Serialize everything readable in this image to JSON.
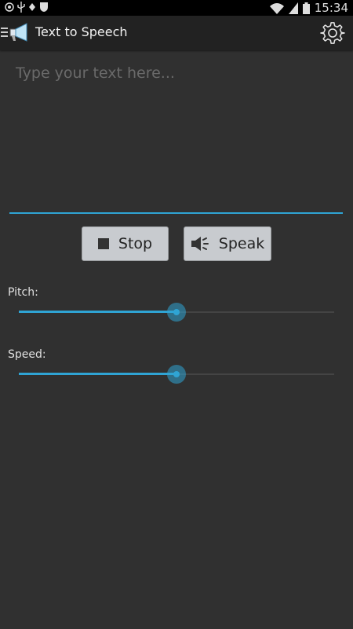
{
  "status_bar": {
    "time": "15:34",
    "left_icons": [
      "shield-icon",
      "usb-icon",
      "android-icon",
      "security-icon"
    ],
    "right_icons": [
      "wifi-icon",
      "signal-icon",
      "battery-icon"
    ]
  },
  "action_bar": {
    "title": "Text to Speech",
    "menu_icon": "menu-icon",
    "app_icon": "megaphone-icon",
    "settings_icon": "gear-icon"
  },
  "text_input": {
    "placeholder": "Type your text here...",
    "value": ""
  },
  "buttons": {
    "stop_label": "Stop",
    "speak_label": "Speak"
  },
  "sliders": {
    "pitch": {
      "label": "Pitch:",
      "value_fraction": 0.5
    },
    "speed": {
      "label": "Speed:",
      "value_fraction": 0.5
    }
  },
  "colors": {
    "accent": "#2fa4d4",
    "background": "#303030",
    "action_bar": "#222222",
    "button": "#c8cbcf"
  }
}
